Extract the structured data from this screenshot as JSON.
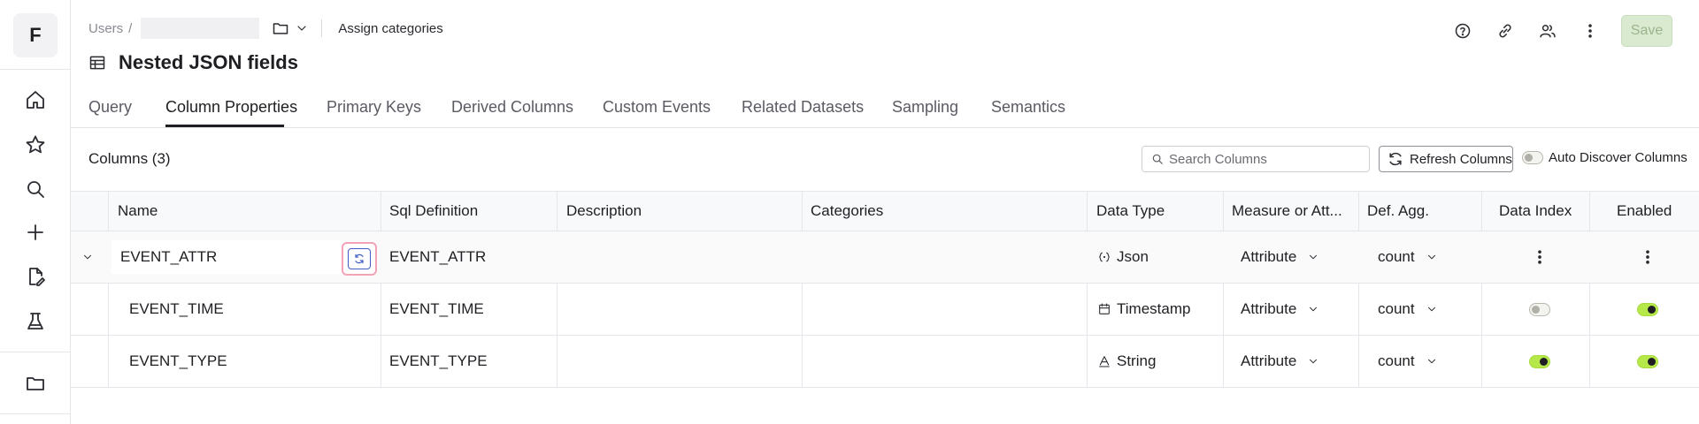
{
  "app": {
    "logo_letter": "F"
  },
  "breadcrumb": {
    "root": "Users",
    "separator": "/",
    "assign_label": "Assign categories"
  },
  "page": {
    "title": "Nested JSON fields"
  },
  "header_actions": {
    "save_label": "Save"
  },
  "tabs": [
    {
      "label": "Query",
      "active": false
    },
    {
      "label": "Column Properties",
      "active": true
    },
    {
      "label": "Primary Keys",
      "active": false
    },
    {
      "label": "Derived Columns",
      "active": false
    },
    {
      "label": "Custom Events",
      "active": false
    },
    {
      "label": "Related Datasets",
      "active": false
    },
    {
      "label": "Sampling",
      "active": false
    },
    {
      "label": "Semantics",
      "active": false
    }
  ],
  "toolbar": {
    "columns_count": "Columns (3)",
    "search_placeholder": "Search Columns",
    "refresh_label": "Refresh Columns",
    "auto_discover_label": "Auto Discover Columns",
    "auto_discover_on": false
  },
  "table": {
    "headers": [
      "Name",
      "Sql Definition",
      "Description",
      "Categories",
      "Data Type",
      "Measure or Att...",
      "Def. Agg.",
      "Data Index",
      "Enabled"
    ],
    "rows": [
      {
        "name": "EVENT_ATTR",
        "sql": "EVENT_ATTR",
        "description": "",
        "categories": "",
        "data_type": "Json",
        "type_icon": "json-icon",
        "measure": "Attribute",
        "agg": "count",
        "data_index": "menu",
        "enabled": "menu"
      },
      {
        "name": "EVENT_TIME",
        "sql": "EVENT_TIME",
        "description": "",
        "categories": "",
        "data_type": "Timestamp",
        "type_icon": "calendar-icon",
        "measure": "Attribute",
        "agg": "count",
        "data_index": "off",
        "enabled": "on"
      },
      {
        "name": "EVENT_TYPE",
        "sql": "EVENT_TYPE",
        "description": "",
        "categories": "",
        "data_type": "String",
        "type_icon": "text-type-icon",
        "measure": "Attribute",
        "agg": "count",
        "data_index": "on",
        "enabled": "on"
      }
    ]
  },
  "colors": {
    "accent_toggle": "#b7e84a",
    "save_bg": "#d9ead0",
    "highlight": "#f2a3b5"
  }
}
